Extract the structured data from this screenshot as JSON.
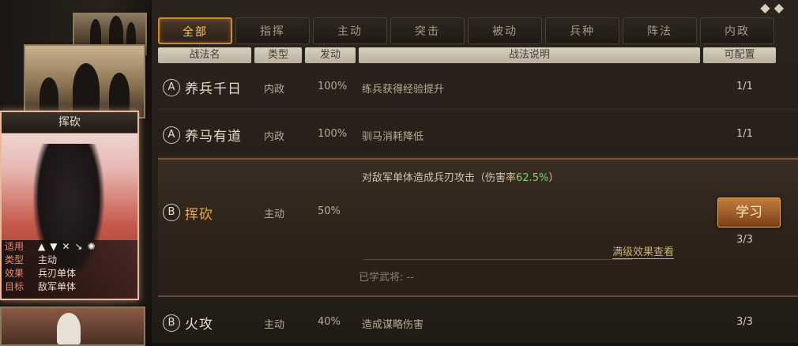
{
  "tabs": [
    {
      "label": "全部",
      "active": true
    },
    {
      "label": "指挥"
    },
    {
      "label": "主动"
    },
    {
      "label": "突击"
    },
    {
      "label": "被动"
    },
    {
      "label": "兵种"
    },
    {
      "label": "阵法"
    },
    {
      "label": "内政"
    }
  ],
  "headers": {
    "name": "战法名",
    "type": "类型",
    "trigger": "发动",
    "description": "战法说明",
    "config": "可配置"
  },
  "skills": [
    {
      "grade": "A",
      "name": "养兵千日",
      "type": "内政",
      "rate": "100%",
      "desc": "练兵获得经验提升",
      "config": "1/1"
    },
    {
      "grade": "A",
      "name": "养马有道",
      "type": "内政",
      "rate": "100%",
      "desc": "驯马消耗降低",
      "config": "1/1"
    },
    {
      "grade": "B",
      "name": "挥砍",
      "type": "主动",
      "rate": "50%",
      "desc_prefix": "对敌军单体造成兵刃攻击（伤害率",
      "desc_highlight": "62.5%",
      "desc_suffix": "）",
      "config": "3/3"
    },
    {
      "grade": "B",
      "name": "火攻",
      "type": "主动",
      "rate": "40%",
      "desc": "造成谋略伤害",
      "config": "3/3"
    }
  ],
  "expanded": {
    "learn_button": "学习",
    "full_effect": "满级效果查看",
    "learned_label": "已学武将: --"
  },
  "card": {
    "title": "挥砍",
    "rows": [
      {
        "key": "适用",
        "val": ""
      },
      {
        "key": "类型",
        "val": "主动"
      },
      {
        "key": "效果",
        "val": "兵刃单体"
      },
      {
        "key": "目标",
        "val": "敌军单体"
      }
    ],
    "troop_icons": [
      "cavalry-icon",
      "shield-icon",
      "bow-icon",
      "spear-icon",
      "siege-icon"
    ]
  }
}
